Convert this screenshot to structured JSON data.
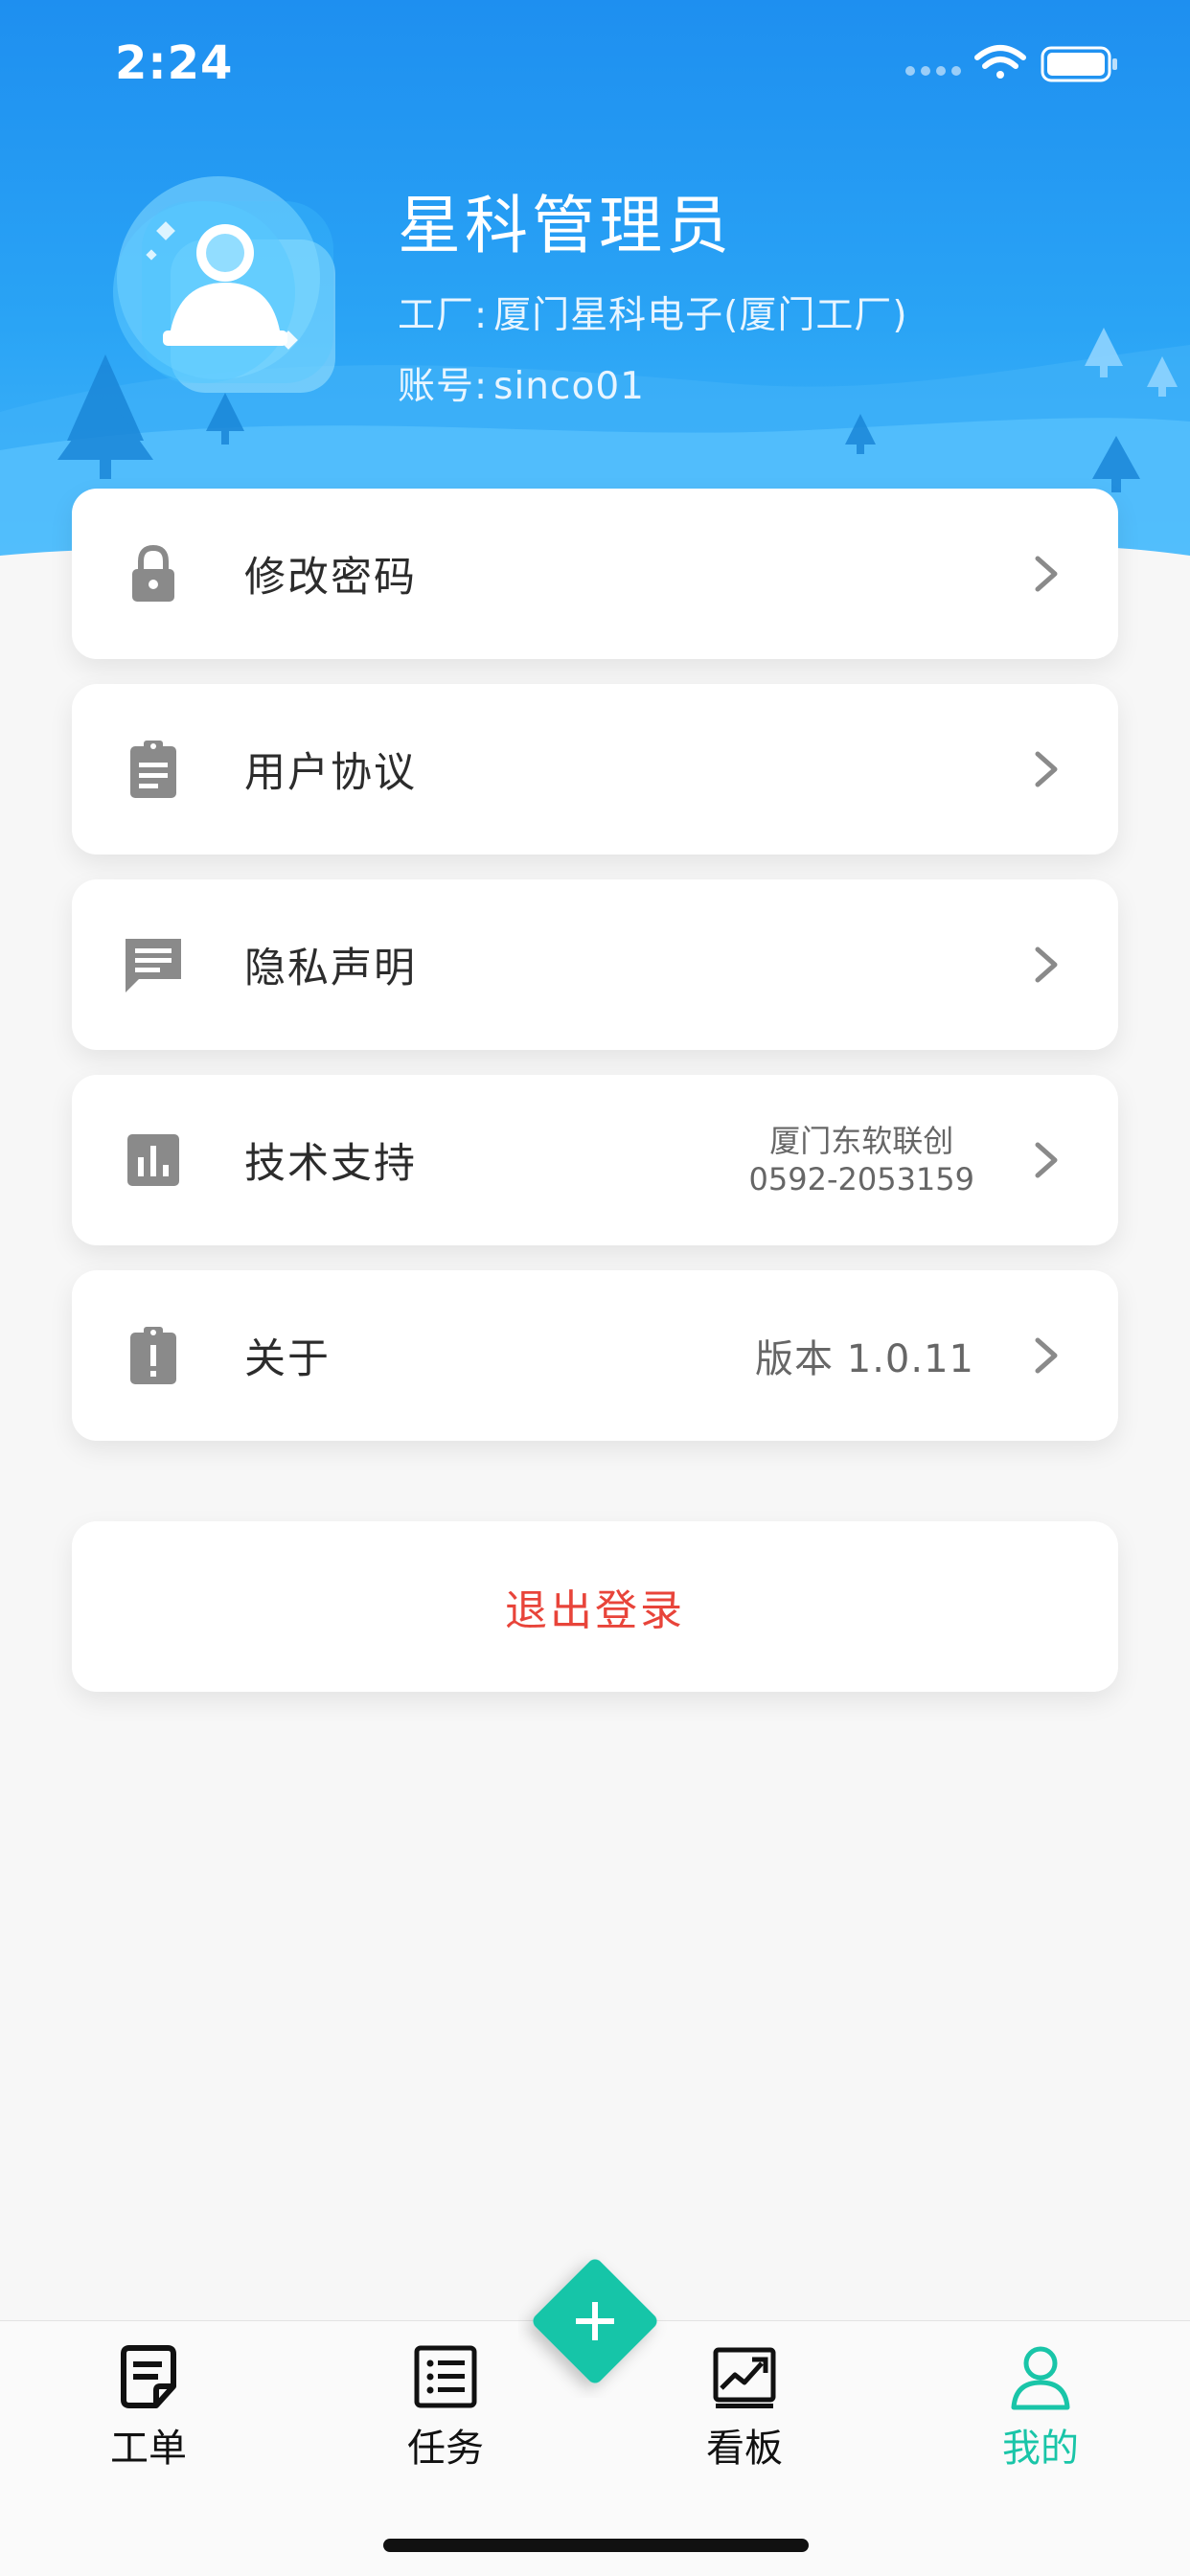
{
  "status_bar": {
    "time": "2:24"
  },
  "profile": {
    "name": "星科管理员",
    "factory_label": "工厂:",
    "factory_value": "厦门星科电子(厦门工厂)",
    "account_label": "账号:",
    "account_value": "sinco01"
  },
  "menu": {
    "change_password": {
      "label": "修改密码",
      "icon": "lock-icon"
    },
    "user_agreement": {
      "label": "用户协议",
      "icon": "clipboard-icon"
    },
    "privacy": {
      "label": "隐私声明",
      "icon": "message-icon"
    },
    "support": {
      "label": "技术支持",
      "icon": "bar-chart-icon",
      "company": "厦门东软联创",
      "phone": "0592-2053159"
    },
    "about": {
      "label": "关于",
      "icon": "alert-clipboard-icon",
      "version": "版本 1.0.11"
    }
  },
  "logout_label": "退出登录",
  "tabs": [
    {
      "label": "工单",
      "icon": "work-order-icon"
    },
    {
      "label": "任务",
      "icon": "task-list-icon"
    },
    {
      "label": "看板",
      "icon": "dashboard-chart-icon"
    },
    {
      "label": "我的",
      "icon": "person-icon"
    }
  ],
  "fab": {
    "icon": "plus-icon"
  },
  "colors": {
    "header_blue": "#1e8ff0",
    "accent_teal": "#19c5a8",
    "logout_red": "#e8443a",
    "icon_gray": "#8a8a8a"
  }
}
